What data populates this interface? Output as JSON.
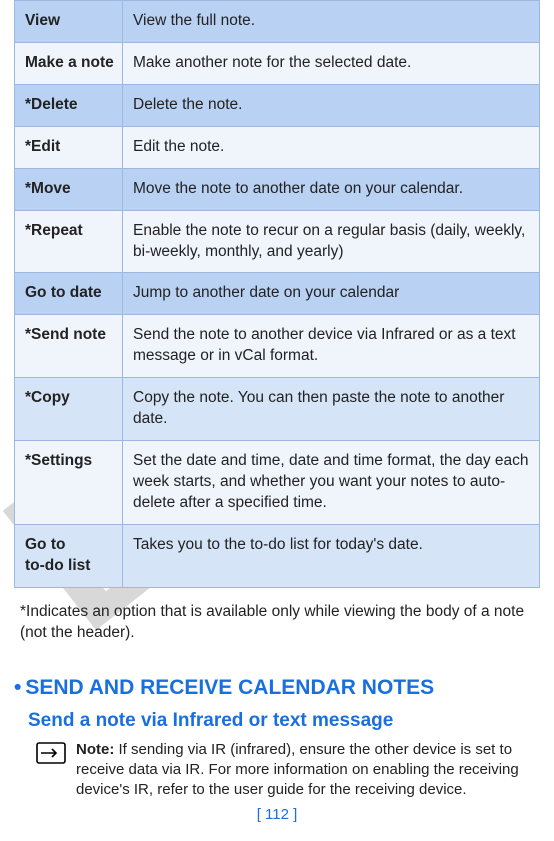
{
  "watermark": "DR",
  "table": {
    "rows": [
      {
        "label": "View",
        "desc": "View the full note."
      },
      {
        "label": "Make a note",
        "desc": "Make another note for the selected date."
      },
      {
        "label": "*Delete",
        "desc": "Delete the note."
      },
      {
        "label": "*Edit",
        "desc": "Edit the note."
      },
      {
        "label": "*Move",
        "desc": "Move the note to another date on your calendar."
      },
      {
        "label": "*Repeat",
        "desc": "Enable the note to recur on a regular basis (daily, weekly, bi-weekly, monthly, and yearly)"
      },
      {
        "label": "Go to date",
        "desc": "Jump to another date on your calendar"
      },
      {
        "label": "*Send note",
        "desc": "Send the note to another device via Infrared or as a text message or in vCal format."
      },
      {
        "label": "*Copy",
        "desc": "Copy the note. You can then paste the note to another date."
      },
      {
        "label": "*Settings",
        "desc": "Set the date and time, date and time format, the day each week starts, and whether you want your notes to auto-delete after a specified time."
      },
      {
        "label": "Go to\nto-do list",
        "desc": "Takes you to the to-do list for today's date."
      }
    ]
  },
  "footnote": "*Indicates an option that is available only while viewing the body of a note (not the header).",
  "heading1_bullet": "•",
  "heading1": "SEND AND RECEIVE CALENDAR NOTES",
  "heading2": "Send a note via Infrared or text message",
  "note_label": "Note: ",
  "note_body": "If sending via IR (infrared), ensure the other device is set to receive data via IR. For more information on enabling the receiving device's IR, refer to the user guide for the receiving device.",
  "page_number": "[ 112 ]"
}
